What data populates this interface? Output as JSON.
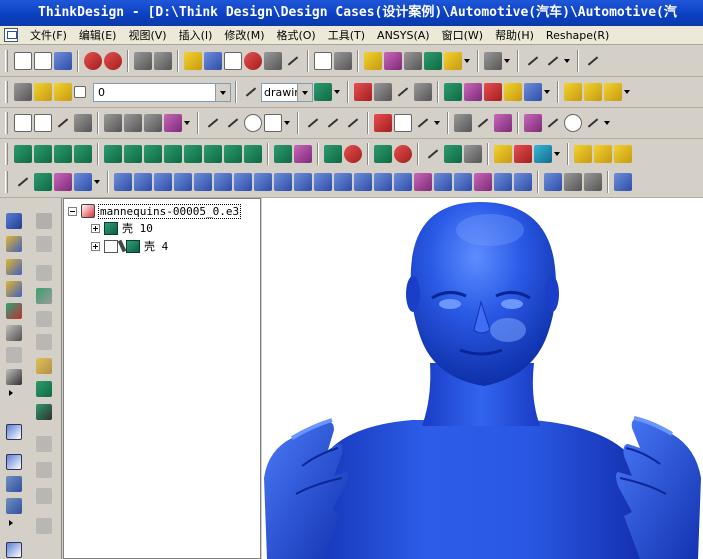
{
  "window": {
    "title": "ThinkDesign  - [D:\\Think Design\\Design Cases(设计案例)\\Automotive(汽车)\\Automotive(汽"
  },
  "menu": {
    "items": [
      {
        "label": "文件(F)"
      },
      {
        "label": "编辑(E)"
      },
      {
        "label": "视图(V)"
      },
      {
        "label": "插入(I)"
      },
      {
        "label": "修改(M)"
      },
      {
        "label": "格式(O)"
      },
      {
        "label": "工具(T)"
      },
      {
        "label": "ANSYS(A)"
      },
      {
        "label": "窗口(W)"
      },
      {
        "label": "帮助(H)"
      },
      {
        "label": "Reshape(R)"
      }
    ]
  },
  "toolbar": {
    "layer_value": "0",
    "render_mode": "drawir"
  },
  "tree": {
    "root_label": "mannequins-00005_0.e3",
    "items": [
      {
        "label": "壳 10"
      },
      {
        "label": "壳 4"
      }
    ]
  },
  "colors": {
    "titlebar": "#0a3fc0",
    "model_blue": "#1a4fd8",
    "viewport_bg": "#ffffff"
  }
}
